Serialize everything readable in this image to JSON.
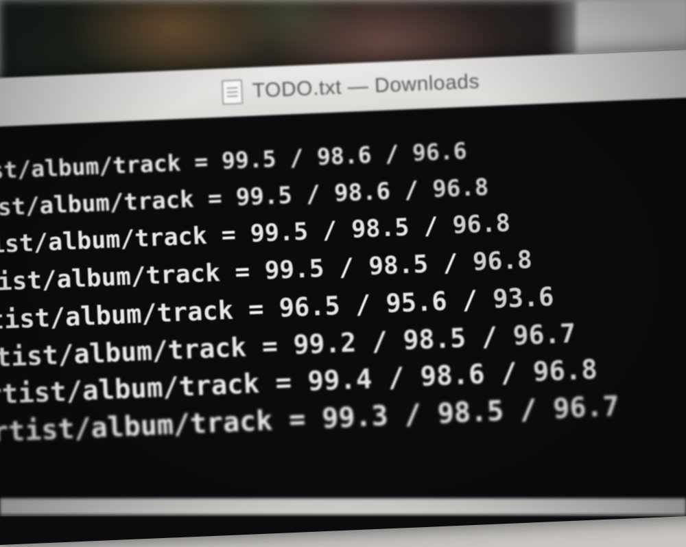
{
  "window": {
    "title": "TODO.txt — Downloads",
    "icon": "text-document-icon"
  },
  "lines": [
    {
      "path": "artist/album/track",
      "eq": "=",
      "v1": "99.5",
      "v2": "98.6",
      "v3": "96.6"
    },
    {
      "path": "artist/album/track",
      "eq": "=",
      "v1": "99.5",
      "v2": "98.6",
      "v3": "96.8"
    },
    {
      "path": "artist/album/track",
      "eq": "=",
      "v1": "99.5",
      "v2": "98.5",
      "v3": "96.8"
    },
    {
      "path": "artist/album/track",
      "eq": "=",
      "v1": "99.5",
      "v2": "98.5",
      "v3": "96.8"
    },
    {
      "path": "artist/album/track",
      "eq": "=",
      "v1": "96.5",
      "v2": "95.6",
      "v3": "93.6"
    },
    {
      "path": "artist/album/track",
      "eq": "=",
      "v1": "99.2",
      "v2": "98.5",
      "v3": "96.7"
    },
    {
      "path": "artist/album/track",
      "eq": "=",
      "v1": "99.4",
      "v2": "98.6",
      "v3": "96.8"
    },
    {
      "path": "artist/album/track",
      "eq": "=",
      "v1": "99.3",
      "v2": "98.5",
      "v3": "96.7"
    }
  ],
  "separator": "/"
}
